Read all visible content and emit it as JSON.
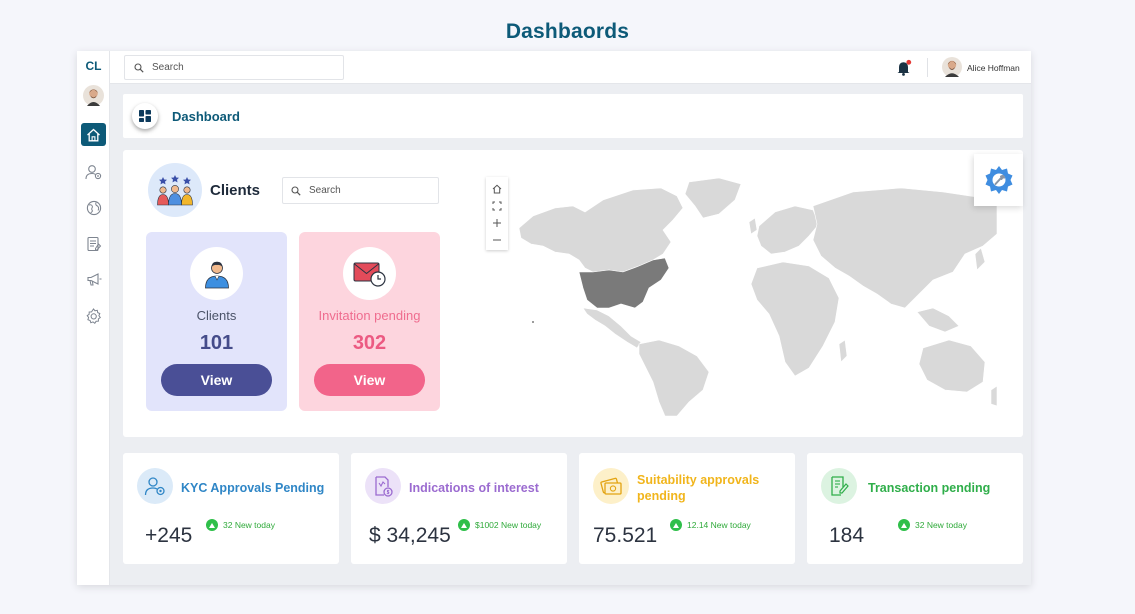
{
  "page": {
    "title": "Dashbaords"
  },
  "sidebar": {
    "logo": "CL",
    "items": [
      {
        "icon": "home-icon",
        "active": true
      },
      {
        "icon": "user-settings-icon",
        "active": false
      },
      {
        "icon": "globe-icon",
        "active": false
      },
      {
        "icon": "document-icon",
        "active": false
      },
      {
        "icon": "megaphone-icon",
        "active": false
      },
      {
        "icon": "gear-icon",
        "active": false
      }
    ]
  },
  "topbar": {
    "search_placeholder": "Search",
    "user_name": "Alice Hoffman",
    "notification_dot_color": "#e53935"
  },
  "dashboard_header": {
    "label": "Dashboard"
  },
  "clients": {
    "title": "Clients",
    "search_placeholder": "Search",
    "tiles": [
      {
        "label": "Clients",
        "value": "101",
        "button": "View",
        "color": "#4a4f96"
      },
      {
        "label": "Invitation pending",
        "value": "302",
        "button": "View",
        "color": "#f2648a"
      }
    ]
  },
  "map": {
    "controls": [
      "home-icon",
      "selection-icon",
      "zoom-in-icon",
      "zoom-out-icon"
    ],
    "highlighted_region": "United States",
    "highlight_color": "#7a7a7a",
    "land_color": "#d9d9d9"
  },
  "metrics": [
    {
      "title": "KYC Approvals Pending",
      "value": "+245",
      "new_today": "32 New today",
      "color": "#2f86c6",
      "icon": "user-gear-icon"
    },
    {
      "title": "Indications of interest",
      "value": "$ 34,245",
      "new_today": "$1002 New today",
      "color": "#9b6bd0",
      "icon": "money-document-icon"
    },
    {
      "title": "Suitability approvals pending",
      "value": "75.521",
      "new_today": "12.14 New today",
      "color": "#f1b51c",
      "icon": "cash-icon"
    },
    {
      "title": "Transaction pending",
      "value": "184",
      "new_today": "32 New today",
      "color": "#2fae4a",
      "icon": "contract-icon"
    }
  ]
}
